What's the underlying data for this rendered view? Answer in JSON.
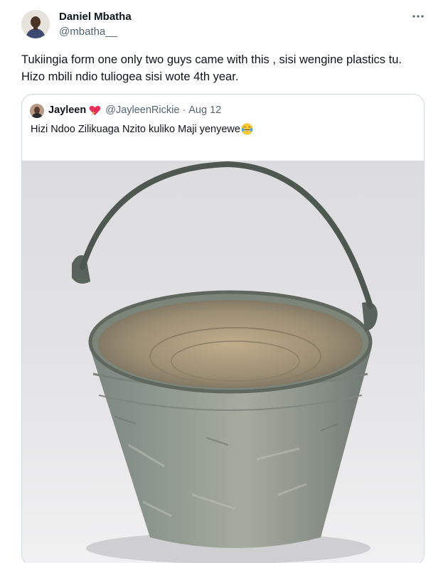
{
  "tweet": {
    "author_name": "Daniel Mbatha",
    "author_handle": "@mbatha__",
    "more_icon": "more-horizontal-icon",
    "text": "Tukiingia form one only two guys came with this , sisi wengine plastics tu. Hizo mbili ndio tuliogea sisi wote 4th year."
  },
  "quote": {
    "name": "Jayleen",
    "badge_emoji": "heart-with-ribbon-icon",
    "handle": "@JayleenRickie",
    "separator": "·",
    "date": "Aug 12",
    "text": "Hizi Ndoo Zilikuaga Nzito kuliko Maji yenyewe",
    "text_emoji": "face-with-tears-of-joy-icon",
    "media": "old-metal-bucket-photo"
  },
  "colors": {
    "text_primary": "#0f1419",
    "text_secondary": "#536471",
    "border": "#cfd9de",
    "background": "#ffffff"
  }
}
